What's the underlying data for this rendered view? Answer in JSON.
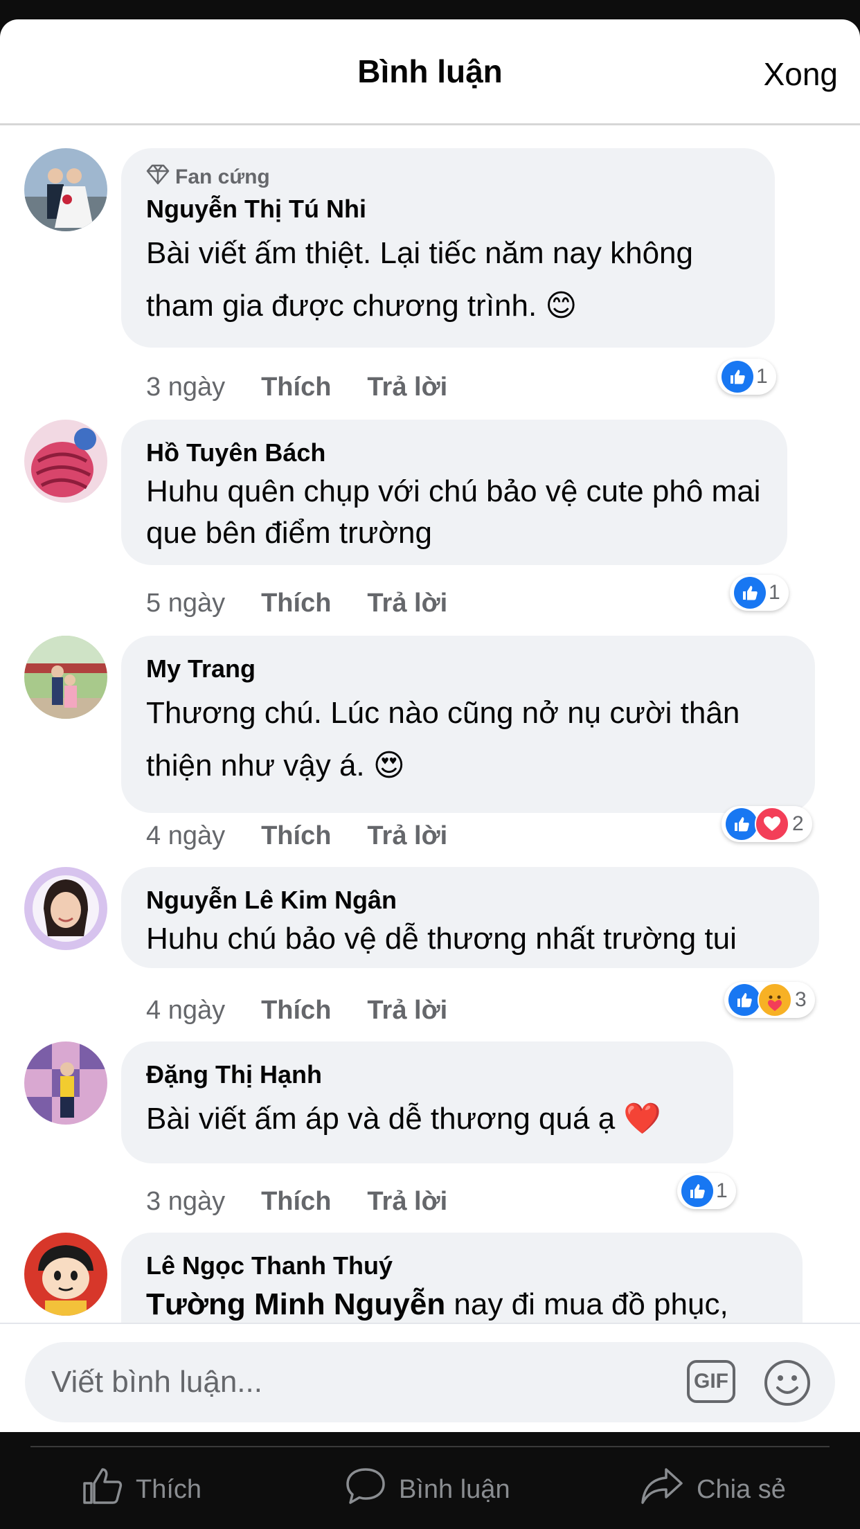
{
  "header": {
    "title": "Bình luận",
    "done_label": "Xong"
  },
  "comments": [
    {
      "badge": "Fan cứng",
      "author": "Nguyễn Thị Tú Nhi",
      "text": "Bài viết ấm thiệt. Lại tiếc năm nay không tham gia được chương trình. 😊",
      "time": "3 ngày",
      "like_label": "Thích",
      "reply_label": "Trả lời",
      "reaction_count": "1"
    },
    {
      "author": "Hồ Tuyên Bách",
      "text": "Huhu quên chụp với chú bảo vệ cute phô mai que bên điểm trường",
      "time": "5 ngày",
      "like_label": "Thích",
      "reply_label": "Trả lời",
      "reaction_count": "1"
    },
    {
      "author": "My Trang",
      "text": "Thương chú. Lúc nào cũng nở nụ cười thân thiện như vậy á. 😍",
      "time": "4 ngày",
      "like_label": "Thích",
      "reply_label": "Trả lời",
      "reaction_count": "2"
    },
    {
      "author": "Nguyễn Lê Kim Ngân",
      "text": "Huhu chú bảo vệ dễ thương nhất trường tui",
      "time": "4 ngày",
      "like_label": "Thích",
      "reply_label": "Trả lời",
      "reaction_count": "3"
    },
    {
      "author": "Đặng Thị Hạnh",
      "text": "Bài viết ấm áp và dễ thương quá ạ ❤️",
      "time": "3 ngày",
      "like_label": "Thích",
      "reply_label": "Trả lời",
      "reaction_count": "1"
    },
    {
      "author": "Lê Ngọc Thanh Thuý",
      "mention": "Tường Minh Nguyễn",
      "text": " nay đi mua đồ phục,"
    }
  ],
  "composer": {
    "placeholder": "Viết bình luận...",
    "gif_label": "GIF"
  },
  "tabbar": {
    "like": "Thích",
    "comment": "Bình luận",
    "share": "Chia sẻ"
  },
  "colors": {
    "like_blue": "#1877f2",
    "bubble_gray": "#f0f2f5",
    "meta_gray": "#65676b",
    "heart_red": "#f33e58"
  }
}
